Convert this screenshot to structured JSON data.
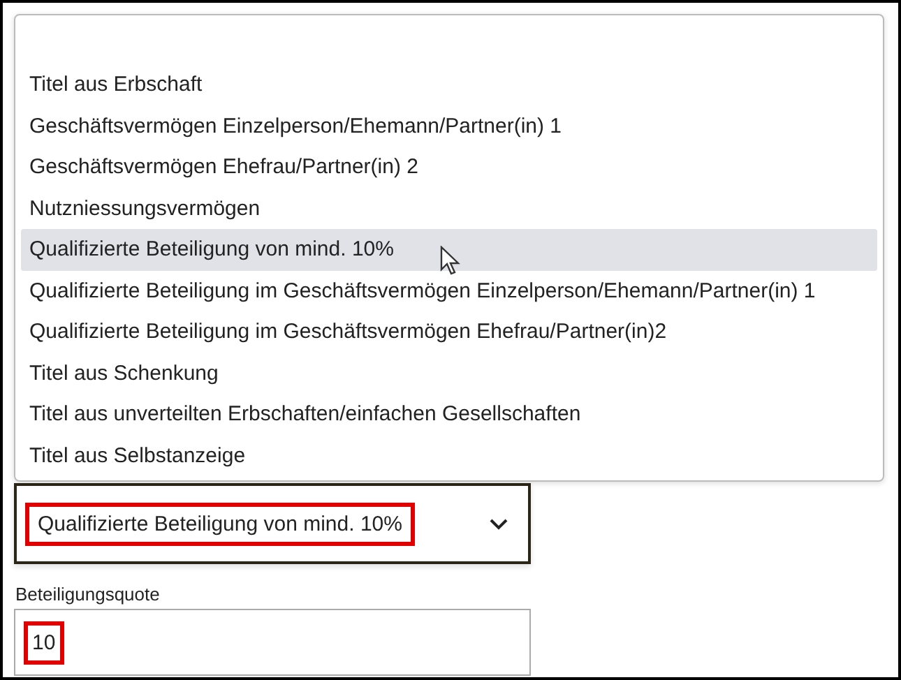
{
  "dropdown": {
    "options": [
      {
        "label": "Titel aus Erbschaft",
        "selected": false
      },
      {
        "label": "Geschäftsvermögen Einzelperson/Ehemann/Partner(in) 1",
        "selected": false
      },
      {
        "label": "Geschäftsvermögen Ehefrau/Partner(in) 2",
        "selected": false
      },
      {
        "label": "Nutzniessungsvermögen",
        "selected": false
      },
      {
        "label": "Qualifizierte Beteiligung von mind. 10%",
        "selected": true
      },
      {
        "label": "Qualifizierte Beteiligung im Geschäftsvermögen Einzelperson/Ehemann/Partner(in) 1",
        "selected": false
      },
      {
        "label": "Qualifizierte Beteiligung im Geschäftsvermögen Ehefrau/Partner(in)2",
        "selected": false
      },
      {
        "label": "Titel aus Schenkung",
        "selected": false
      },
      {
        "label": "Titel aus unverteilten Erbschaften/einfachen Gesellschaften",
        "selected": false
      },
      {
        "label": "Titel aus Selbstanzeige",
        "selected": false
      }
    ]
  },
  "select": {
    "value": "Qualifizierte Beteiligung von mind. 10%",
    "highlighted": true
  },
  "field": {
    "label": "Beteiligungsquote",
    "value": "10",
    "highlighted": true
  }
}
